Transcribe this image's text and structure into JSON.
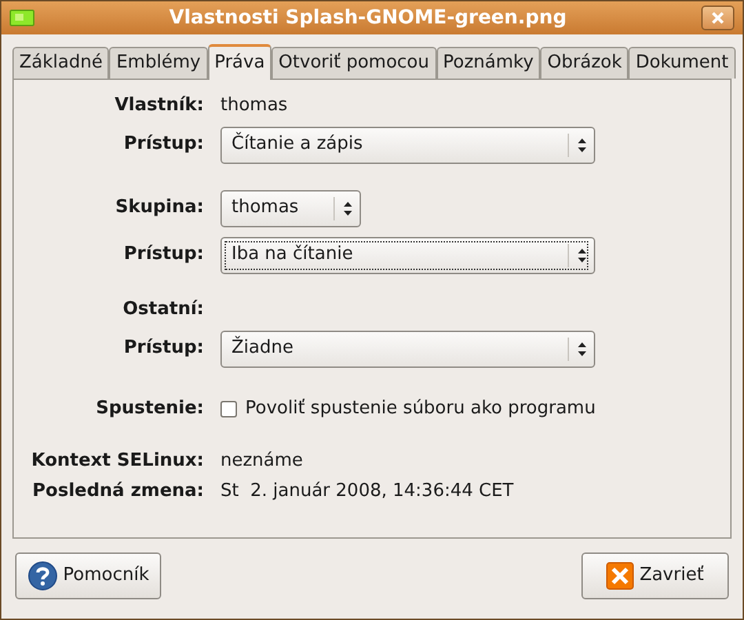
{
  "window": {
    "title": "Vlastnosti Splash-GNOME-green.png"
  },
  "tabs": [
    {
      "label": "Základné",
      "selected": false
    },
    {
      "label": "Emblémy",
      "selected": false
    },
    {
      "label": "Práva",
      "selected": true
    },
    {
      "label": "Otvoriť pomocou",
      "selected": false
    },
    {
      "label": "Poznámky",
      "selected": false
    },
    {
      "label": "Obrázok",
      "selected": false
    },
    {
      "label": "Dokument",
      "selected": false
    }
  ],
  "rows": [
    {
      "kind": "text",
      "label": "Vlastník:",
      "value": "thomas"
    },
    {
      "kind": "combo",
      "label": "Prístup:",
      "value": "Čítanie a zápis",
      "focused": false,
      "wide": true
    },
    {
      "kind": "combo",
      "label": "Skupina:",
      "value": "thomas",
      "focused": false,
      "wide": false
    },
    {
      "kind": "combo",
      "label": "Prístup:",
      "value": "Iba na čítanie",
      "focused": true,
      "wide": true
    },
    {
      "kind": "heading",
      "label": "Ostatní:"
    },
    {
      "kind": "combo",
      "label": "Prístup:",
      "value": "Žiadne",
      "focused": false,
      "wide": true
    },
    {
      "kind": "checkbox",
      "label": "Spustenie:",
      "value": "Povoliť spustenie súboru ako programu",
      "checked": false
    },
    {
      "kind": "text",
      "label": "Kontext SELinux:",
      "value": "neznáme"
    },
    {
      "kind": "text",
      "label": "Posledná zmena:",
      "value": "St  2. január 2008, 14:36:44 CET"
    }
  ],
  "buttons": [
    {
      "kind": "help",
      "label": "Pomocník"
    },
    {
      "kind": "close",
      "label": "Zavrieť"
    }
  ]
}
